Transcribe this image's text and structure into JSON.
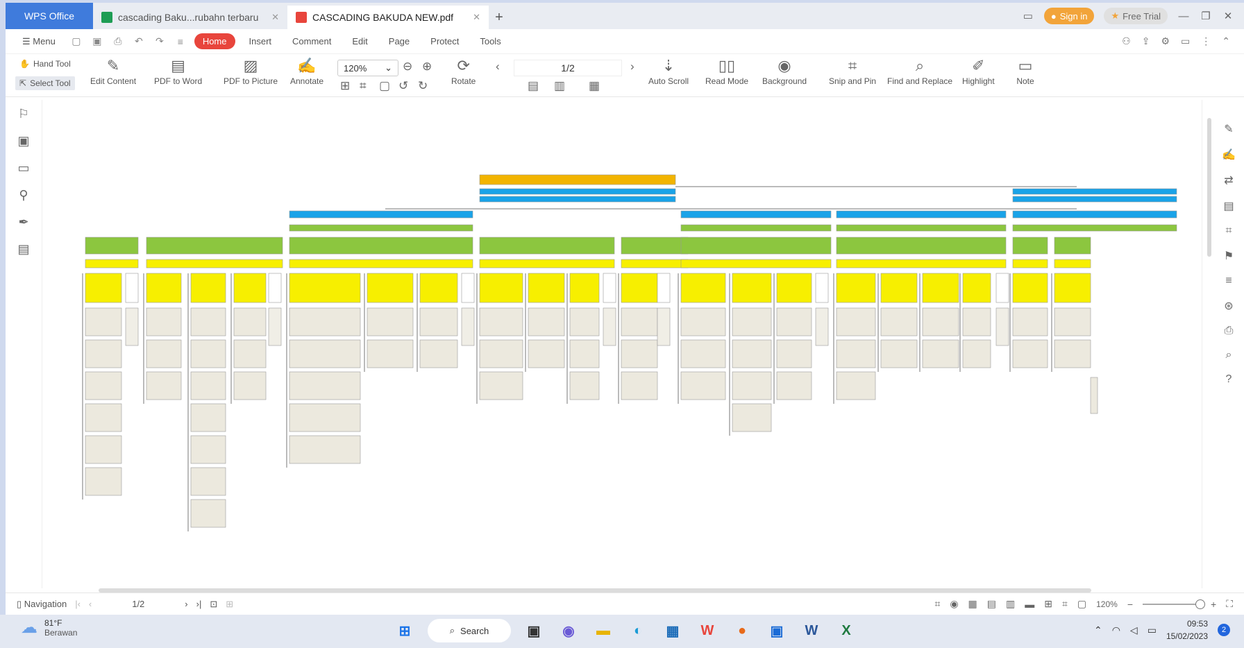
{
  "tabs": {
    "wps": "WPS Office",
    "doc1": "cascading Baku...rubahn terbaru",
    "doc2": "CASCADING BAKUDA NEW.pdf"
  },
  "header": {
    "sign_in": "Sign in",
    "free_trial": "Free Trial"
  },
  "menu": {
    "menu": "Menu",
    "home": "Home",
    "insert": "Insert",
    "comment": "Comment",
    "edit": "Edit",
    "page": "Page",
    "protect": "Protect",
    "tools": "Tools"
  },
  "ribbon": {
    "hand_tool": "Hand Tool",
    "select_tool": "Select Tool",
    "edit_content": "Edit Content",
    "pdf_to_word": "PDF to Word",
    "pdf_to_picture": "PDF to Picture",
    "annotate": "Annotate",
    "zoom": "120%",
    "rotate": "Rotate",
    "page": "1/2",
    "auto_scroll": "Auto Scroll",
    "read_mode": "Read Mode",
    "background": "Background",
    "snip_and_pin": "Snip and Pin",
    "find_and_replace": "Find and Replace",
    "highlight": "Highlight",
    "note": "Note"
  },
  "status": {
    "navigation": "Navigation",
    "page": "1/2",
    "zoom": "120%"
  },
  "taskbar": {
    "temp": "81°F",
    "weather": "Berawan",
    "search": "Search",
    "time": "09:53",
    "date": "15/02/2023"
  },
  "colors": {
    "orange": "#f2b400",
    "blue": "#1aa3e8",
    "green": "#8cc63f",
    "yellow": "#f7ef00",
    "box": "#ece9de",
    "accent": "#e8453c"
  }
}
